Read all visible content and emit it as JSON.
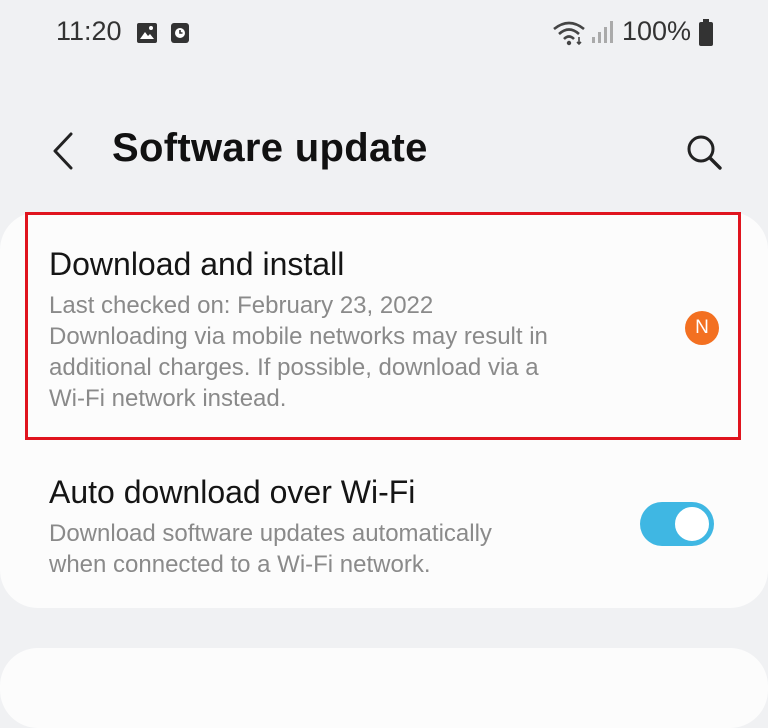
{
  "status_bar": {
    "time": "11:20",
    "battery": "100%",
    "icons": [
      "gallery-icon",
      "clock-notification-icon",
      "wifi-icon",
      "signal-icon",
      "battery-icon"
    ]
  },
  "header": {
    "title": "Software update",
    "back_icon": "chevron-left-icon",
    "search_icon": "search-icon"
  },
  "settings": {
    "download_install": {
      "title": "Download and install",
      "last_checked": "Last checked on: February 23, 2022",
      "warning": "Downloading via mobile networks may result in\nadditional charges. If possible, download via a\nWi-Fi network instead.",
      "badge": "N"
    },
    "auto_download": {
      "title": "Auto download over Wi-Fi",
      "description": "Download software updates automatically\nwhen connected to a Wi-Fi network.",
      "enabled": true
    }
  },
  "colors": {
    "background": "#f0f1f3",
    "card": "#fcfcfc",
    "accent": "#3fb7e3",
    "badge": "#f37021",
    "highlight": "#e0141e",
    "secondary_text": "#8a8a8a"
  }
}
